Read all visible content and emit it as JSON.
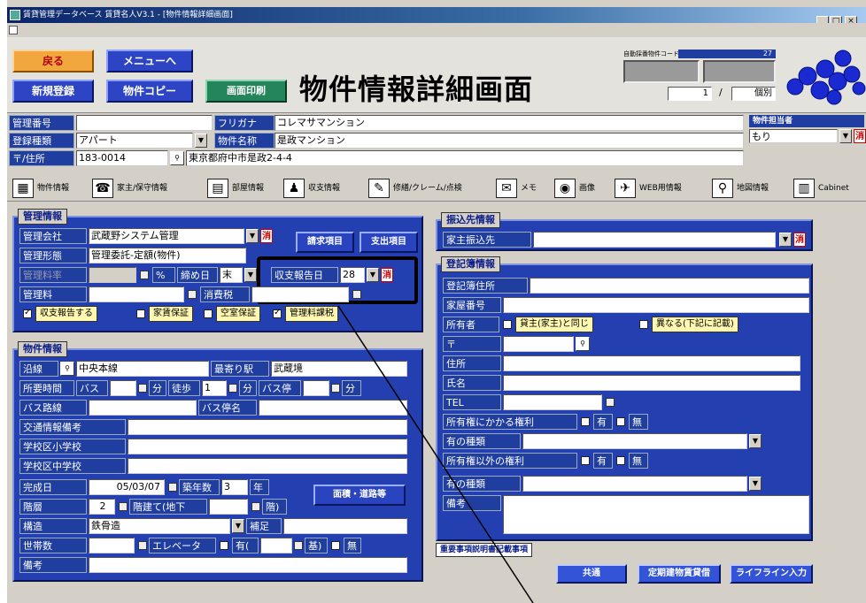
{
  "window": {
    "title": "賃貸管理データベース 賃貸名人V3.1 - [物件情報詳細画面]",
    "min": "_",
    "restore": "□",
    "close": "×"
  },
  "header": {
    "back": "戻る",
    "menu": "メニューへ",
    "new": "新規登録",
    "copy": "物件コピー",
    "print": "画面印刷",
    "page_title": "物件情報詳細画面",
    "auto_code_label": "自動採番物件コード",
    "auto_code_value": "27",
    "record_no": "1",
    "sep": "/",
    "record_total": "個別"
  },
  "topfields": {
    "kanri_no_label": "管理番号",
    "kanri_no": "",
    "furigana_label": "フリガナ",
    "furigana": "コレマサマンション",
    "shubetsu_label": "登録種類",
    "shubetsu": "アパート",
    "bukken_name_label": "物件名称",
    "bukken_name": "是政マンション",
    "address_label": "〒/住所",
    "zip": "183-0014",
    "address": "東京都府中市是政2-4-4",
    "tantou_label": "物件担当者",
    "tantou": "もり"
  },
  "tabs": [
    {
      "icon": "▦",
      "label": "物件情報"
    },
    {
      "icon": "☎",
      "label": "家主/保守情報"
    },
    {
      "icon": "▤",
      "label": "部屋情報"
    },
    {
      "icon": "♟",
      "label": "収支情報"
    },
    {
      "icon": "✎",
      "label": "修繕/クレーム/点検"
    },
    {
      "icon": "✉",
      "label": "メモ"
    },
    {
      "icon": "◉",
      "label": "画像"
    },
    {
      "icon": "✈",
      "label": "WEB用情報"
    },
    {
      "icon": "⚲",
      "label": "地図情報"
    },
    {
      "icon": "▥",
      "label": "Cabinet"
    }
  ],
  "kanri": {
    "title": "管理情報",
    "company_label": "管理会社",
    "company": "武蔵野システム管理",
    "keitai_label": "管理形態",
    "keitai": "管理委託-定額(物件)",
    "ryoritsu_label": "管理料率",
    "percent": "%",
    "shime_label": "締め日",
    "shime": "末",
    "shushi_label": "収支報告日",
    "shushi": "28",
    "ryo_label": "管理料",
    "shohizei": "消費税",
    "seikyu_btn": "請求項目",
    "shiharai_btn": "支出項目",
    "chk1": "収支報告する",
    "chk2": "家賃保証",
    "chk3": "空室保証",
    "chk4": "管理料課税"
  },
  "bukken": {
    "title": "物件情報",
    "ensen_label": "沿線",
    "ensen": "中央本線",
    "eki_label": "最寄り駅",
    "eki": "武蔵境",
    "jikan_label": "所要時間",
    "bus": "バス",
    "fun1": "分",
    "toho": "徒歩",
    "toho_val": "1",
    "fun2": "分",
    "busstop": "バス停",
    "fun3": "分",
    "busroute_label": "バス路線",
    "busstop_name_label": "バス停名",
    "kotsu_label": "交通情報備考",
    "shogaku_label": "学校区小学校",
    "chugaku_label": "学校区中学校",
    "kansei_label": "完成日",
    "kansei": "05/03/07",
    "chiku_label": "築年数",
    "chiku": "3",
    "nen": "年",
    "kaiso_label": "階層",
    "kaiso": "2",
    "kaidate": "階建て(地下",
    "kai": "階)",
    "kozo_label": "構造",
    "kozo": "鉄骨造",
    "hosoku": "補足",
    "setai_label": "世帯数",
    "elevator": "エレベータ",
    "yu": "有(",
    "ki": "基)",
    "mu": "無",
    "biko_label": "備考",
    "menseki_btn": "面積・道路等"
  },
  "furikomi": {
    "title": "振込先情報",
    "label": "家主振込先"
  },
  "toki": {
    "title": "登記簿情報",
    "jusho_label": "登記簿住所",
    "kaoku_label": "家屋番号",
    "shoyu_label": "所有者",
    "opt1": "貸主(家主)と同じ",
    "opt2": "異なる(下記に記載)",
    "zip_label": "〒",
    "jusho2_label": "住所",
    "shimei_label": "氏名",
    "tel_label": "TEL",
    "kenri1_label": "所有権にかかる権利",
    "yu": "有",
    "mu": "無",
    "shurui1_label": "有の種類",
    "kenri2_label": "所有権以外の権利",
    "yu2": "有",
    "mu2": "無",
    "shurui2_label": "有の種類",
    "biko_label": "備考"
  },
  "bottom": {
    "juyo": "重要事項説明書記載事項",
    "kyotsu": "共通",
    "teiki": "定期建物賃貸借",
    "lifeline": "ライフライン入力"
  }
}
